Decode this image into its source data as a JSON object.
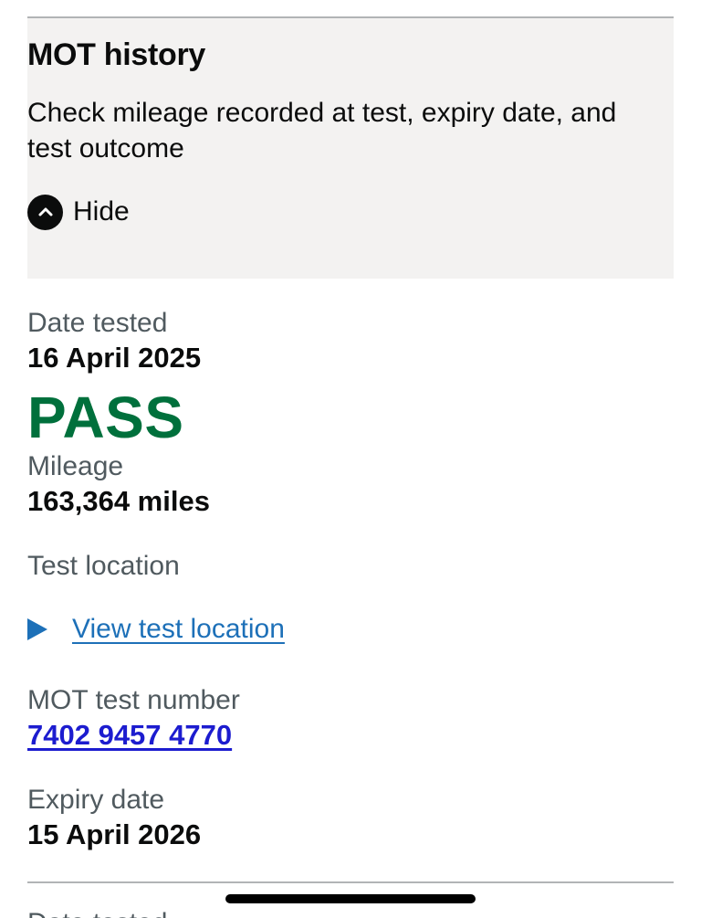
{
  "accordion": {
    "title": "MOT history",
    "summary": "Check mileage recorded at test, expiry date, and test outcome",
    "toggle_label": "Hide",
    "toggle_icon": "chevron-up-icon"
  },
  "test": {
    "date_label": "Date tested",
    "date_value": "16 April 2025",
    "result": "PASS",
    "result_color": "#00703c",
    "mileage_label": "Mileage",
    "mileage_value": "163,364 miles",
    "location_label": "Test location",
    "location_link": "View test location",
    "test_number_label": "MOT test number",
    "test_number_value": "7402 9457 4770",
    "expiry_label": "Expiry date",
    "expiry_value": "15 April 2026"
  },
  "next_entry": {
    "date_label": "Date tested"
  },
  "colors": {
    "link": "#1d70b8",
    "test_number_link": "#1c1ccf",
    "panel_bg": "#f3f2f1",
    "secondary_text": "#505a5f"
  }
}
